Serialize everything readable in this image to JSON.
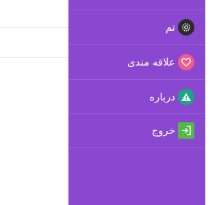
{
  "menu": {
    "items": [
      {
        "label": "تم",
        "icon": "gear-icon",
        "icon_bg": "#2b2b2b"
      },
      {
        "label": "علاقه مندی",
        "icon": "heart-icon",
        "icon_bg": "#f25c8a"
      },
      {
        "label": "درباره",
        "icon": "warning-icon",
        "icon_bg": "#1aa683"
      },
      {
        "label": "خروج",
        "icon": "exit-icon",
        "icon_bg": "#55b94a"
      }
    ]
  },
  "colors": {
    "drawer_bg": "#8a47cf",
    "text": "#ffffff"
  }
}
